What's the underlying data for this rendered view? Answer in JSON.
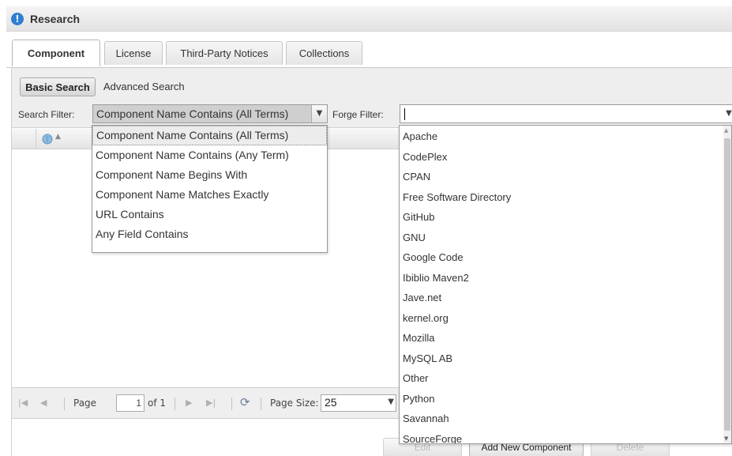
{
  "header": {
    "title": "Research",
    "icon": "info-icon"
  },
  "tabs": [
    {
      "label": "Component",
      "active": true
    },
    {
      "label": "License",
      "active": false
    },
    {
      "label": "Third-Party Notices",
      "active": false
    },
    {
      "label": "Collections",
      "active": false
    }
  ],
  "toolbar": {
    "basic_search_label": "Basic Search",
    "advanced_search_label": "Advanced Search",
    "search_filter_label": "Search Filter:",
    "search_filter_value": "Component Name Contains (All Terms)",
    "forge_filter_label": "Forge Filter:",
    "forge_filter_value": ""
  },
  "search_filter_options": [
    {
      "label": "Component Name Contains (All Terms)",
      "selected": true
    },
    {
      "label": "Component Name Contains (Any Term)",
      "selected": false
    },
    {
      "label": "Component Name Begins With",
      "selected": false
    },
    {
      "label": "Component Name Matches Exactly",
      "selected": false
    },
    {
      "label": "URL Contains",
      "selected": false
    },
    {
      "label": "Any Field Contains",
      "selected": false
    }
  ],
  "forge_filter_options": [
    "Apache",
    "CodePlex",
    "CPAN",
    "Free Software Directory",
    "GitHub",
    "GNU",
    "Google Code",
    "Ibiblio Maven2",
    "Jave.net",
    "kernel.org",
    "Mozilla",
    "MySQL AB",
    "Other",
    "Python",
    "Savannah",
    "SourceForge"
  ],
  "pager": {
    "page_label": "Page",
    "page_value": "1",
    "of_label": "of 1",
    "page_size_label": "Page Size:",
    "page_size_value": "25"
  },
  "actions": {
    "edit_label": "Edit",
    "add_new_label": "Add New Component",
    "delete_label": "Delete"
  },
  "colors": {
    "info_icon": "#2f7fd0",
    "selected_combo_bg": "#cfcfcf"
  }
}
